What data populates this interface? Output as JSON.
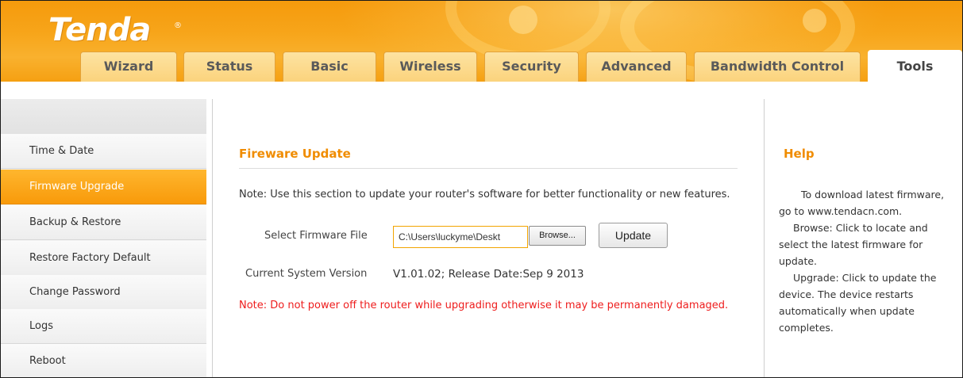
{
  "brand": {
    "logo_text": "Tenda",
    "registered": "®"
  },
  "nav": {
    "tabs": [
      {
        "label": "Wizard"
      },
      {
        "label": "Status"
      },
      {
        "label": "Basic"
      },
      {
        "label": "Wireless"
      },
      {
        "label": "Security"
      },
      {
        "label": "Advanced"
      },
      {
        "label": "Bandwidth Control"
      },
      {
        "label": "Tools",
        "active": true
      }
    ]
  },
  "sidebar": {
    "items": [
      {
        "label": "Time & Date"
      },
      {
        "label": "Firmware Upgrade",
        "active": true
      },
      {
        "label": "Backup & Restore"
      },
      {
        "label": "Restore Factory Default"
      },
      {
        "label": "Change Password"
      },
      {
        "label": "Logs"
      },
      {
        "label": "Reboot"
      }
    ]
  },
  "main": {
    "title": "Fireware Update",
    "note": "Note: Use this section to update your router's software for better functionality or new features.",
    "select_label": "Select Firmware File",
    "file_value": "C:\\Users\\luckyme\\Deskt",
    "browse_label": "Browse...",
    "update_label": "Update",
    "version_label": "Current System Version",
    "version_value": "V1.01.02; Release Date:Sep 9 2013",
    "warning": "Note: Do not power off the router while upgrading otherwise it may be permanently damaged."
  },
  "help": {
    "title": "Help",
    "p1": "To download latest firmware, go to www.tendacn.com.",
    "p2": "Browse: Click to locate and select the latest firmware for update.",
    "p3": "Upgrade: Click to update the device. The device restarts automatically when update completes."
  },
  "colors": {
    "accent": "#f08c00",
    "warning": "#ee1d1d",
    "header": "#f7a51a"
  }
}
